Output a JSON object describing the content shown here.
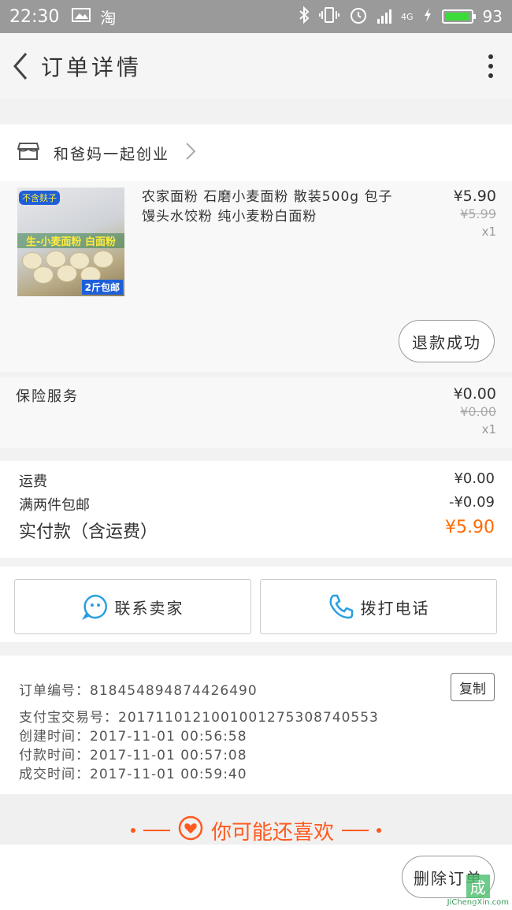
{
  "status_bar": {
    "time": "22:30",
    "app_icon": "淘",
    "network": "4G",
    "battery": "93"
  },
  "navbar": {
    "title": "订单详情"
  },
  "shop": {
    "name": "和爸妈一起创业"
  },
  "product": {
    "image_tags": {
      "top": "不含麸子",
      "middle": "生-小麦面粉 白面粉",
      "bottom": "2斤包邮"
    },
    "title": "农家面粉 石磨小麦面粉 散装500g 包子馒头水饺粉 纯小麦粉白面粉",
    "price": "¥5.90",
    "original_price": "¥5.99",
    "quantity": "x1",
    "refund_status": "退款成功"
  },
  "insurance": {
    "label": "保险服务",
    "price": "¥0.00",
    "original_price": "¥0.00",
    "quantity": "x1"
  },
  "fees": {
    "shipping_label": "运费",
    "shipping_value": "¥0.00",
    "discount_label": "满两件包邮",
    "discount_value": "-¥0.09",
    "total_label": "实付款（含运费）",
    "total_value": "¥5.90",
    "accent_color": "#ff6a00"
  },
  "actions": {
    "contact_seller": "联系卖家",
    "call_phone": "拨打电话"
  },
  "order_info": {
    "order_no": "订单编号：818454894874426490",
    "alipay_no": "支付宝交易号：2017110121001001275308740553",
    "created": "创建时间：2017-11-01  00:56:58",
    "paid": "付款时间：2017-11-01  00:57:08",
    "completed": "成交时间：2017-11-01  00:59:40",
    "copy_label": "复制"
  },
  "recommend": {
    "title": "你可能还喜欢"
  },
  "bottom": {
    "delete_label": "删除订单"
  },
  "watermark": {
    "logo": "集成网",
    "url": "JiChengXin.com"
  }
}
